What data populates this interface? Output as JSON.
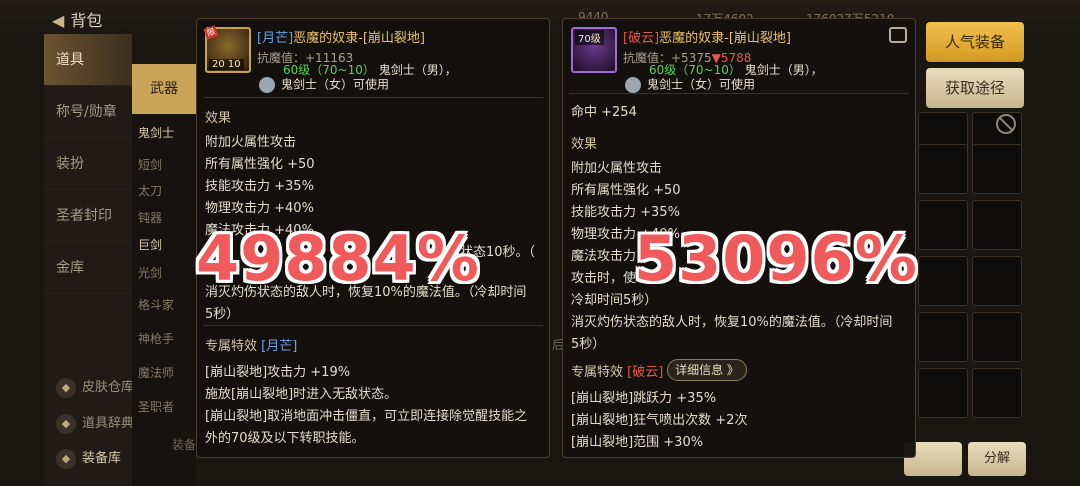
{
  "topbar": {
    "back_label": "背包",
    "dim_a": "9440",
    "dim_b": "17万4602",
    "dim_c": "176027万5210"
  },
  "leftnav": {
    "items": [
      "道具",
      "称号/勋章",
      "装扮",
      "圣者封印",
      "金库"
    ],
    "lower": [
      "皮肤仓库",
      "道具辞典",
      "装备库"
    ]
  },
  "subnav": {
    "head": "武器",
    "items": [
      "鬼剑士",
      "短剑",
      "太刀",
      "钝器",
      "巨剑",
      "光剑",
      "格斗家",
      "神枪手",
      "魔法师",
      "圣职者"
    ]
  },
  "right": {
    "popular_label": "人气装备",
    "obtain_label": "获取途径",
    "decompose_label": "分解"
  },
  "middle": {
    "hint_a": "后",
    "hint_b": "装备"
  },
  "left_panel": {
    "level_badge": "20 10",
    "tag": "限",
    "title_prefix": "[月芒]",
    "title_name": "恶魔的奴隶-[崩山裂地]",
    "resist": "抗魔值：+11163",
    "req_green": "60级（70~10）",
    "req_class1": "鬼剑士（男），",
    "req_class2": "鬼剑士（女）可使用",
    "effects_head": "效果",
    "effects": [
      "附加火属性攻击",
      "所有属性强化 +50",
      "技能攻击力 +35%",
      "物理攻击力 +40%",
      "魔法攻击力 +40%"
    ],
    "tail1": "伤状态10秒。（",
    "tail2": "消灭灼伤状态的敌人时，恢复10%的魔法值。（冷却时间",
    "tail3": "5秒）",
    "special_head": "专属特效",
    "special_tag": "[月芒]",
    "special": [
      "[崩山裂地]攻击力 +19%",
      "施放[崩山裂地]时进入无敌状态。",
      "[崩山裂地]取消地面冲击僵直，可立即连接除觉醒技能之",
      "外的70级及以下转职技能。"
    ]
  },
  "right_panel": {
    "level_badge": "70级",
    "title_prefix": "[破云]",
    "title_name": "恶魔的奴隶-[崩山裂地]",
    "resist": "抗魔值：+5375",
    "resist_down": "▼5788",
    "req_green": "60级（70~10）",
    "req_class1": "鬼剑士（男），",
    "req_class2": "鬼剑士（女）可使用",
    "hit": "命中 +254",
    "effects_head": "效果",
    "effects": [
      "附加火属性攻击",
      "所有属性强化 +50",
      "技能攻击力 +35%",
      "物理攻击力 +40%",
      "魔法攻击力",
      "攻击时，使",
      "冷却时间5秒）",
      "消灭灼伤状态的敌人时，恢复10%的魔法值。（冷却时间",
      "5秒）"
    ],
    "special_head": "专属特效",
    "special_tag": "[破云]",
    "detail_label": "详细信息 》",
    "special": [
      "[崩山裂地]跳跃力 +35%",
      "[崩山裂地]狂气喷出次数 +2次",
      "[崩山裂地]范围 +30%"
    ]
  },
  "overlay": {
    "left_pct": "49884%",
    "right_pct": "53096%"
  },
  "colors": {
    "accent_gold": "#e8c26a",
    "overlay_red": "#f05a5a",
    "green": "#59d15d"
  }
}
